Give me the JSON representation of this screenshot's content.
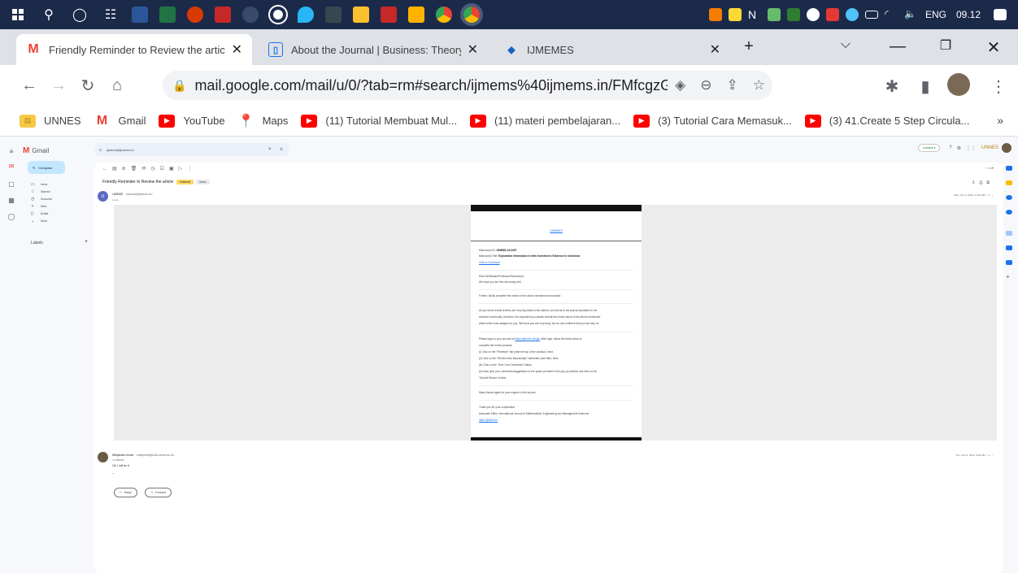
{
  "taskbar": {
    "tray_lang": "ENG",
    "clock": "09.12"
  },
  "tabs": [
    {
      "title": "Friendly Reminder to Review the article",
      "favicon": "M"
    },
    {
      "title": "About the Journal | Business: Theory ar",
      "favicon": "▯"
    },
    {
      "title": "IJMEMES",
      "favicon": "◆"
    }
  ],
  "address_bar": {
    "url": "mail.google.com/mail/u/0/?tab=rm#search/ijmems%40ijmems.in/FMfcgzG..."
  },
  "bookmarks": [
    {
      "label": "UNNES",
      "type": "unnes"
    },
    {
      "label": "Gmail",
      "type": "gmail"
    },
    {
      "label": "YouTube",
      "type": "youtube"
    },
    {
      "label": "Maps",
      "type": "maps"
    },
    {
      "label": "(11) Tutorial Membuat Mul...",
      "type": "youtube"
    },
    {
      "label": "(11) materi pembelajaran...",
      "type": "youtube"
    },
    {
      "label": "(3) Tutorial Cara Memasuk...",
      "type": "youtube"
    },
    {
      "label": "(3) 41.Create 5 Step Circula...",
      "type": "youtube"
    }
  ],
  "gmail": {
    "brand": "Gmail",
    "compose": "Compose",
    "nav": [
      "Inbox",
      "Starred",
      "Snoozed",
      "Sent",
      "Drafts",
      "More"
    ],
    "labels": "Labels",
    "search_value": "ijmems@ijmems.in",
    "status": "Active",
    "account_badge": "UNNES",
    "subject": "Friendly Reminder to Review the article",
    "badge1": "External",
    "badge2": "Inbox",
    "msg1": {
      "avatar": "IJ",
      "from": "IJMEMS",
      "email": "<ijmems@ijmems.in>",
      "to": "to me",
      "date": "Wed, Nov 8, 2023, 11:51 AM"
    },
    "email_body": {
      "logo_link": "IJMEMES",
      "manuscript_id_label": "Manuscript ID:",
      "manuscript_id": "IJMEMS-23-0097",
      "manuscript_title_label": "Manuscript Title:",
      "manuscript_title": "Explorative Information in New Investment: Evidence in Indonesia",
      "download": "Click to Download",
      "greeting": "Dear Sir/Madam/Professor/Researcher,",
      "hope": "We hope you are fine and doing well.",
      "p1": "Further, kindly complete the review of the above-mentioned manuscript.",
      "p2a": "As you know, timely reviews are very important to the authors, as well as to the journal reputation in the",
      "p2b": "research community, therefore it is requested you please submit the review report of the above-mentioned",
      "p2c": "article which was assigned to you. We know you are very busy, but we are confident that you will help us.",
      "p3a": "Please login to your account at",
      "p3link": "https://ijmems.in/login",
      "p3b": "After login, follow the below steps to",
      "p3c": "complete the review process:",
      "s1": "(i) Click on the \"Reviewer\" tab (near the top of the window). Next,",
      "s2": "(ii) Click on the \"Review New Manuscripts\" tab/button (see title). Next,",
      "s3": "(iii) Click on the \"Give Your Comments\" button.",
      "s4a": "(iv) Now, give your comments/suggestions to the space provided in the pop-up window and click on the",
      "s4b": "\"Submit Review\" button.",
      "thanks": "Many thanks again for your support to the journal.",
      "regards": "Thank you for your cooperation.",
      "editor": "Associate Editor, International Journal of Mathematical, Engineering and Management Sciences",
      "sig_link": "https://ijmems.in"
    },
    "msg2": {
      "from": "Wikipedia Unnes",
      "email": "<wikipedia@mail.unnes.ac.id>",
      "to": "to IJMEMS",
      "body": "Ok, I will do it",
      "sig": "--",
      "date": "Thu, Nov 9, 2023, 9:09 AM"
    },
    "reply": "Reply",
    "forward": "Forward"
  }
}
